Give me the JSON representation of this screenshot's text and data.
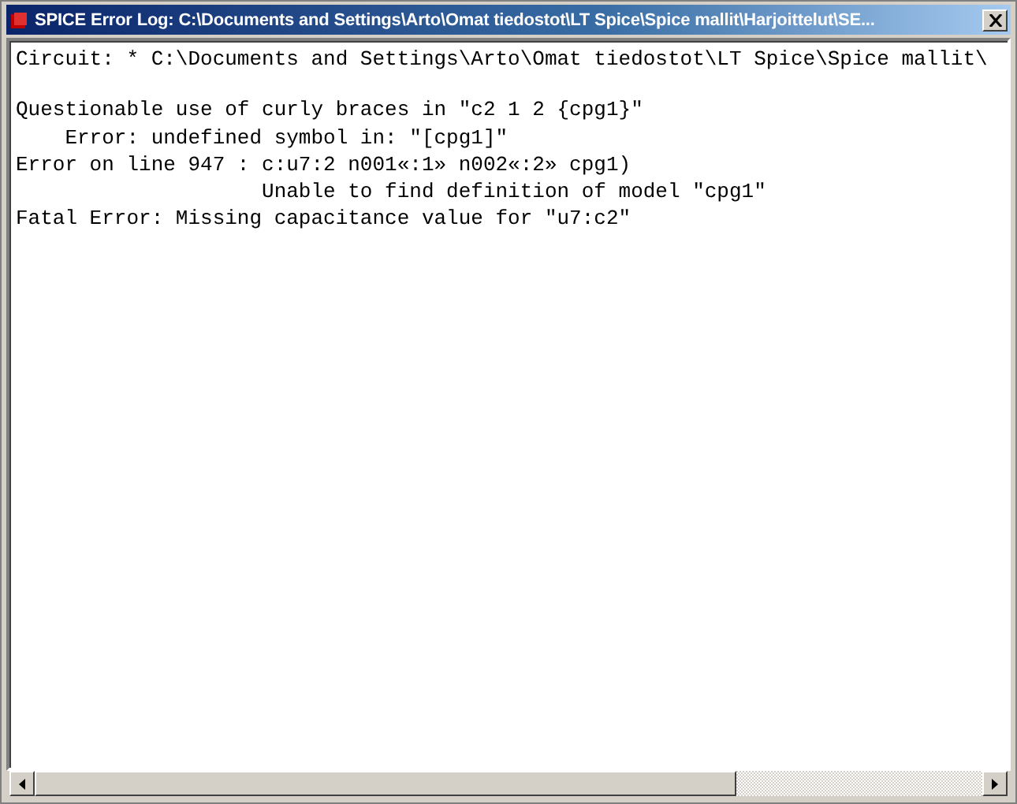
{
  "window": {
    "title": "SPICE Error Log: C:\\Documents and Settings\\Arto\\Omat tiedostot\\LT Spice\\Spice mallit\\Harjoittelut\\SE..."
  },
  "log": {
    "paragraphs": [
      [
        "Circuit: * C:\\Documents and Settings\\Arto\\Omat tiedostot\\LT Spice\\Spice mallit\\"
      ],
      [
        "Questionable use of curly braces in \"c2 1 2 {cpg1}\"",
        "    Error: undefined symbol in: \"[cpg1]\"",
        "Error on line 947 : c:u7:2 n001«:1» n002«:2» cpg1)",
        "                    Unable to find definition of model \"cpg1\"",
        "Fatal Error: Missing capacitance value for \"u7:c2\""
      ]
    ]
  }
}
